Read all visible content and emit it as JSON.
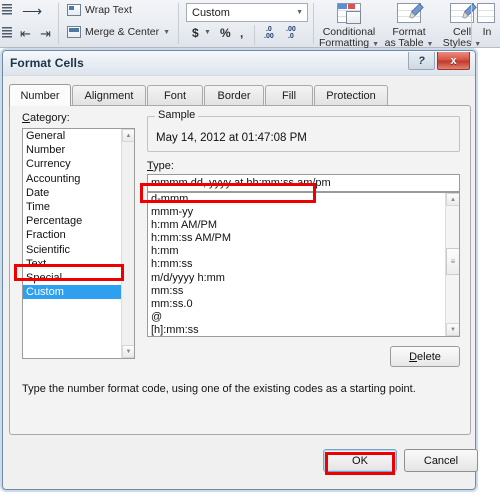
{
  "ribbon": {
    "wrap_text": "Wrap Text",
    "merge_center": "Merge & Center",
    "number_format_value": "Custom",
    "currency_symbol": "$",
    "percent_symbol": "%",
    "comma_symbol": ",",
    "inc_decimal_top": ".0",
    "inc_decimal_bottom": ".00",
    "dec_decimal_top": ".00",
    "dec_decimal_bottom": ".0",
    "buttons": [
      {
        "line1": "Conditional",
        "line2": "Formatting"
      },
      {
        "line1": "Format",
        "line2": "as Table"
      },
      {
        "line1": "Cell",
        "line2": "Styles"
      }
    ],
    "insert_partial": "In"
  },
  "dialog": {
    "title": "Format Cells",
    "help_glyph": "?",
    "close_glyph": "x",
    "tabs": [
      {
        "label": "Number",
        "active": true
      },
      {
        "label": "Alignment",
        "active": false
      },
      {
        "label": "Font",
        "active": false
      },
      {
        "label": "Border",
        "active": false
      },
      {
        "label": "Fill",
        "active": false
      },
      {
        "label": "Protection",
        "active": false
      }
    ],
    "category_label": "Category:",
    "categories": [
      "General",
      "Number",
      "Currency",
      "Accounting",
      "Date",
      "Time",
      "Percentage",
      "Fraction",
      "Scientific",
      "Text",
      "Special",
      "Custom"
    ],
    "category_selected": "Custom",
    "sample_legend": "Sample",
    "sample_value": "May 14, 2012 at 01:47:08 PM",
    "type_label": "Type:",
    "type_value": "mmmm dd, yyyy at hh:mm:ss am/pm",
    "type_list": [
      "d-mmm",
      "mmm-yy",
      "h:mm AM/PM",
      "h:mm:ss AM/PM",
      "h:mm",
      "h:mm:ss",
      "m/d/yyyy h:mm",
      "mm:ss",
      "mm:ss.0",
      "@",
      "[h]:mm:ss"
    ],
    "delete_label": "Delete",
    "hint": "Type the number format code, using one of the existing codes as a starting point.",
    "ok_label": "OK",
    "cancel_label": "Cancel"
  },
  "annotations": {
    "highlight_color": "#ee0000",
    "boxes": [
      "category-custom",
      "type-input",
      "ok-button"
    ]
  }
}
